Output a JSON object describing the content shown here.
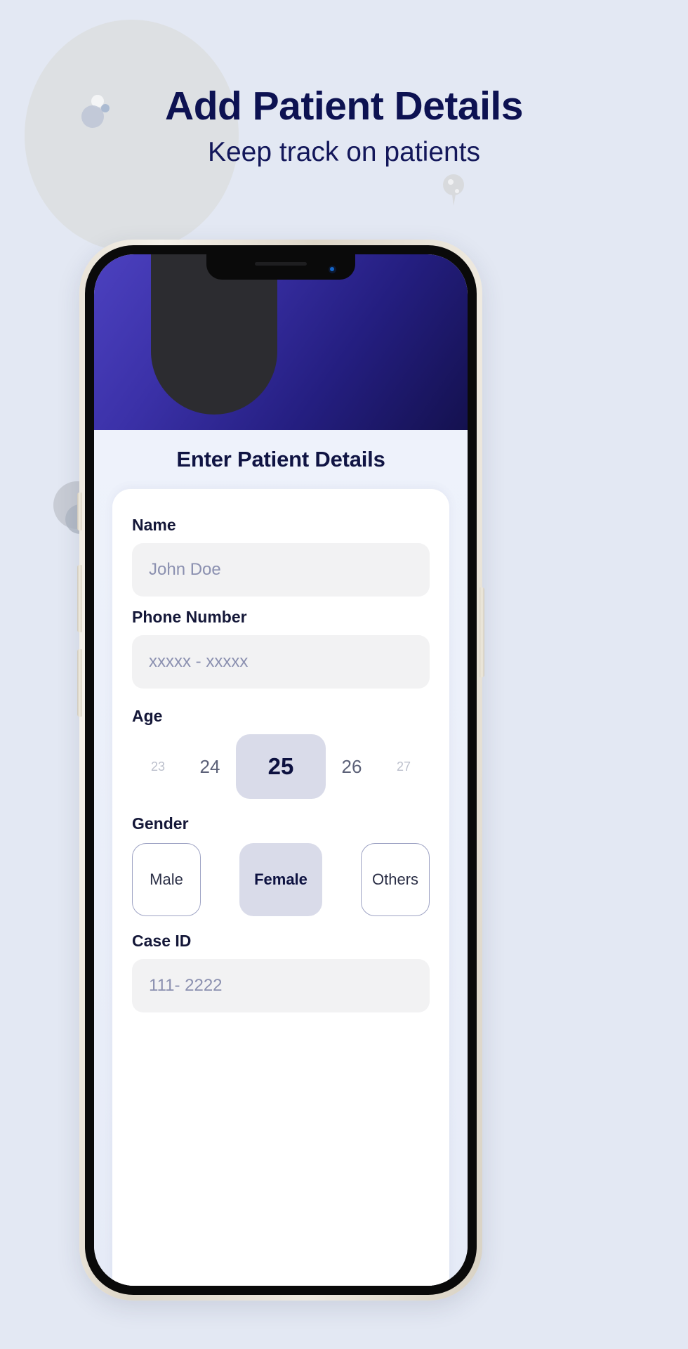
{
  "page": {
    "title": "Add Patient Details",
    "subtitle": "Keep track on patients",
    "background_color": "#e3e8f3",
    "title_color": "#0d1252"
  },
  "decor": {
    "big_circle_color": "#dcdedf",
    "bubble_left_name": "bubble-icon",
    "bubble_right_name": "bubble-icon"
  },
  "phone": {
    "bezel_color": "#e8e2d6",
    "frame_color": "#0a0a0a",
    "notch_name": "notch",
    "buttons": {
      "mute": "mute-switch",
      "volume_up": "volume-up-button",
      "volume_down": "volume-down-button",
      "power": "power-button"
    }
  },
  "app": {
    "header": {
      "gradient_from": "#4c41bf",
      "gradient_to": "#14114f",
      "shape_color": "#2c2c30"
    },
    "screen_title": "Enter Patient Details",
    "form": {
      "name": {
        "label": "Name",
        "value": "",
        "placeholder": "John Doe"
      },
      "phone": {
        "label": "Phone Number",
        "value": "",
        "placeholder": "xxxxx - xxxxx"
      },
      "age": {
        "label": "Age",
        "options": [
          "23",
          "24",
          "25",
          "26",
          "27"
        ],
        "selected": "25",
        "selected_index": 2
      },
      "gender": {
        "label": "Gender",
        "options": [
          "Male",
          "Female",
          "Others"
        ],
        "selected": "Female",
        "selected_index": 1
      },
      "case_id": {
        "label": "Case ID",
        "value": "",
        "placeholder": "111- 2222"
      }
    }
  },
  "colors": {
    "accent_selected": "#d9dbe9",
    "input_bg": "#f2f2f3",
    "placeholder": "#8b90b0",
    "label": "#141738"
  }
}
